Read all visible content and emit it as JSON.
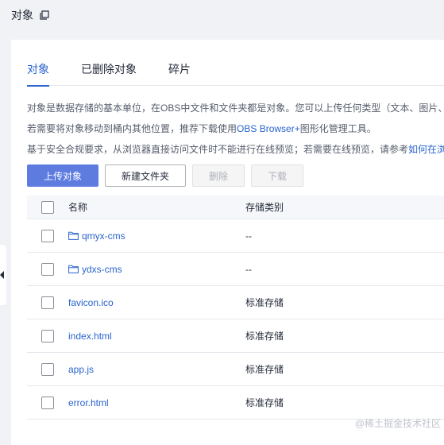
{
  "header": {
    "title": "对象",
    "copy_icon": "copy-icon"
  },
  "tabs": [
    {
      "label": "对象",
      "active": true
    },
    {
      "label": "已删除对象",
      "active": false
    },
    {
      "label": "碎片",
      "active": false
    }
  ],
  "description": {
    "line1": "对象是数据存储的基本单位，在OBS中文件和文件夹都是对象。您可以上传任何类型（文本、图片、",
    "line2_prefix": "若需要将对象移动到桶内其他位置，推荐下载使用",
    "line2_link": "OBS Browser+",
    "line2_suffix": "图形化管理工具。",
    "line3_prefix": "基于安全合规要求，从浏览器直接访问文件时不能进行在线预览；若需要在线预览，请参考",
    "line3_link": "如何在浏"
  },
  "toolbar": {
    "upload": "上传对象",
    "new_folder": "新建文件夹",
    "delete": "删除",
    "download": "下载"
  },
  "table": {
    "headers": {
      "name": "名称",
      "storage": "存储类别"
    },
    "rows": [
      {
        "name": "qmyx-cms",
        "storage": "--",
        "is_folder": true
      },
      {
        "name": "ydxs-cms",
        "storage": "--",
        "is_folder": true
      },
      {
        "name": "favicon.ico",
        "storage": "标准存储",
        "is_folder": false
      },
      {
        "name": "index.html",
        "storage": "标准存储",
        "is_folder": false
      },
      {
        "name": "app.js",
        "storage": "标准存储",
        "is_folder": false
      },
      {
        "name": "error.html",
        "storage": "标准存储",
        "is_folder": false
      }
    ]
  },
  "watermark": "@稀土掘金技术社区",
  "colors": {
    "accent": "#2a64ce",
    "primary_button": "#5e7ce0"
  }
}
